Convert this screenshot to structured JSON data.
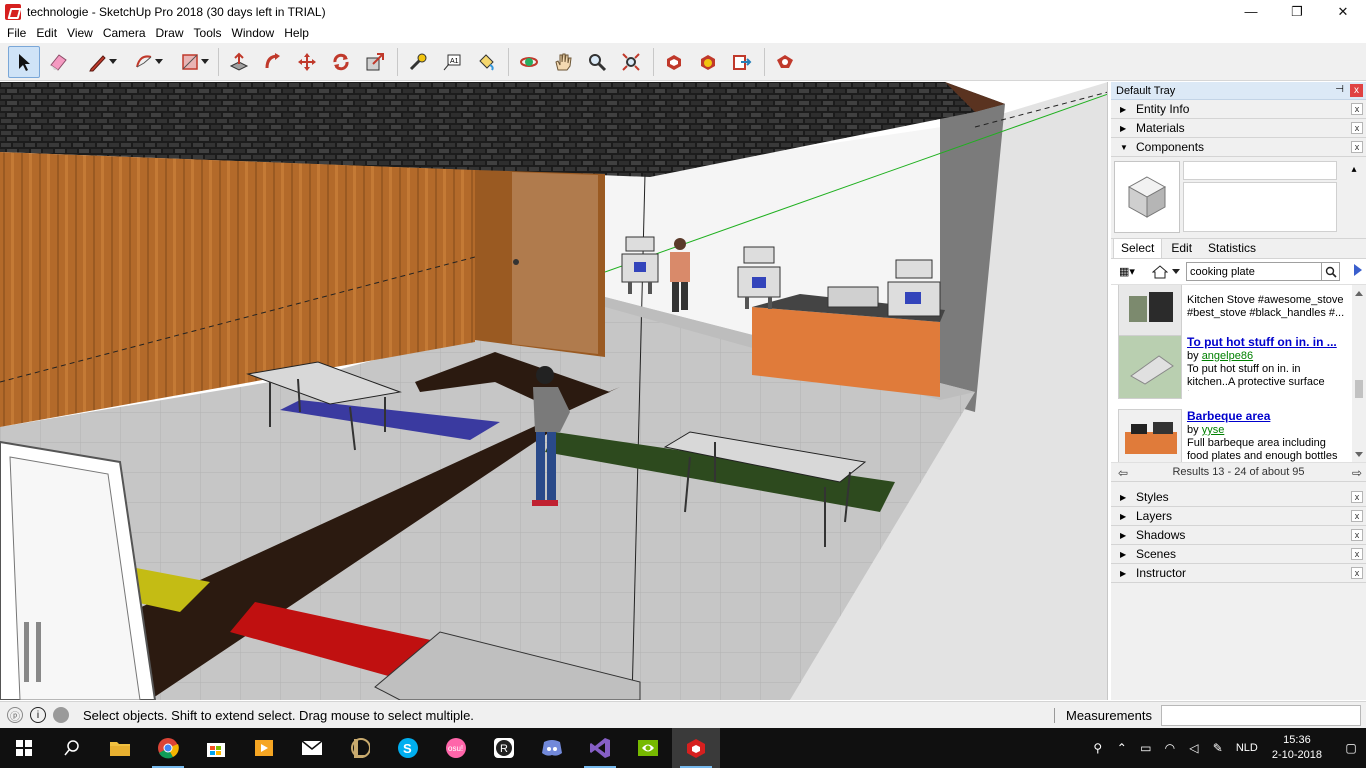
{
  "window": {
    "title": "technologie - SketchUp Pro 2018 (30 days left in TRIAL)",
    "minimize": "—",
    "maximize": "❐",
    "close": "✕"
  },
  "menu": [
    "File",
    "Edit",
    "View",
    "Camera",
    "Draw",
    "Tools",
    "Window",
    "Help"
  ],
  "toolbar": {
    "tools": [
      "select",
      "eraser",
      "pencil",
      "arc",
      "rectangle",
      "push-pull",
      "follow-me",
      "move",
      "rotate",
      "scale",
      "tape-measure",
      "text",
      "paint-bucket",
      "orbit",
      "pan",
      "zoom",
      "zoom-extents",
      "3d-warehouse",
      "extension-warehouse",
      "send-to-layout",
      "extension-manager"
    ]
  },
  "tray": {
    "title": "Default Tray",
    "pin": "⊣",
    "close": "x",
    "panels_top": [
      {
        "label": "Entity Info",
        "expanded": false
      },
      {
        "label": "Materials",
        "expanded": false
      },
      {
        "label": "Components",
        "expanded": true
      }
    ],
    "components": {
      "tabs": [
        "Select",
        "Edit",
        "Statistics"
      ],
      "active_tab": "Select",
      "search_value": "cooking plate",
      "results": [
        {
          "title": "",
          "by_prefix": "",
          "author": "",
          "description": "Kitchen Stove #awesome_stove #best_stove #black_handles #..."
        },
        {
          "title": "To put hot stuff on in. in ...",
          "by_prefix": "by ",
          "author": "angelpe86",
          "description": "To put hot stuff on in. in kitchen..A protective surface to..."
        },
        {
          "title": "Barbeque area",
          "by_prefix": "by ",
          "author": "yyse",
          "description": "Full barbeque area including food plates and enough bottles of be..."
        }
      ],
      "results_nav": "Results 13 - 24 of about 95"
    },
    "panels_bottom": [
      {
        "label": "Styles"
      },
      {
        "label": "Layers"
      },
      {
        "label": "Shadows"
      },
      {
        "label": "Scenes"
      },
      {
        "label": "Instructor"
      }
    ]
  },
  "status": {
    "hint": "Select objects. Shift to extend select. Drag mouse to select multiple.",
    "measurements_label": "Measurements",
    "measurements_value": ""
  },
  "taskbar": {
    "language": "NLD",
    "time": "15:36",
    "date": "2-10-2018"
  },
  "colors": {
    "sketchup_red": "#d6201f",
    "link_blue": "#0000cc",
    "author_green": "#008000",
    "taskbar_bg": "#101010"
  }
}
